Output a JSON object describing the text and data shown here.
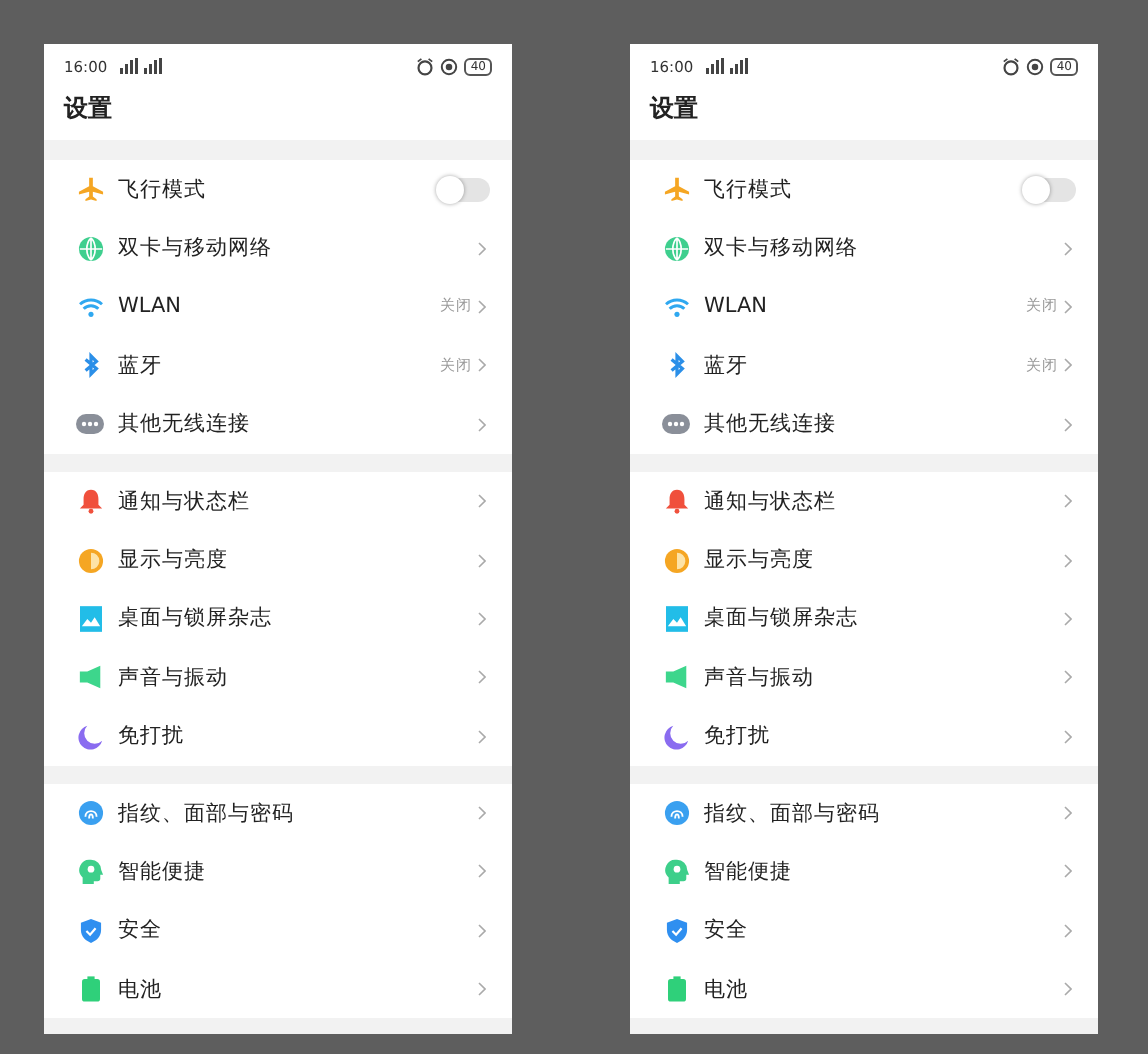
{
  "screens": [
    {
      "status_bar": {
        "time": "16:00",
        "battery": "40"
      },
      "title": "设置",
      "groups": [
        [
          {
            "kind": "toggle",
            "label": "飞行模式",
            "on": false
          },
          {
            "kind": "link",
            "label": "双卡与移动网络"
          },
          {
            "kind": "link",
            "label": "WLAN",
            "value": "关闭"
          },
          {
            "kind": "link",
            "label": "蓝牙",
            "value": "关闭"
          },
          {
            "kind": "link",
            "label": "其他无线连接"
          }
        ],
        [
          {
            "kind": "link",
            "label": "通知与状态栏"
          },
          {
            "kind": "link",
            "label": "显示与亮度"
          },
          {
            "kind": "link",
            "label": "桌面与锁屏杂志"
          },
          {
            "kind": "link",
            "label": "声音与振动"
          },
          {
            "kind": "link",
            "label": "免打扰"
          }
        ],
        [
          {
            "kind": "link",
            "label": "指纹、面部与密码"
          },
          {
            "kind": "link",
            "label": "智能便捷"
          },
          {
            "kind": "link",
            "label": "安全"
          },
          {
            "kind": "link",
            "label": "电池"
          }
        ]
      ]
    },
    {
      "status_bar": {
        "time": "16:00",
        "battery": "40"
      },
      "title": "设置",
      "groups": [
        [
          {
            "kind": "toggle",
            "label": "飞行模式",
            "on": false
          },
          {
            "kind": "link",
            "label": "双卡与移动网络"
          },
          {
            "kind": "link",
            "label": "WLAN",
            "value": "关闭"
          },
          {
            "kind": "link",
            "label": "蓝牙",
            "value": "关闭"
          },
          {
            "kind": "link",
            "label": "其他无线连接"
          }
        ],
        [
          {
            "kind": "link",
            "label": "通知与状态栏"
          },
          {
            "kind": "link",
            "label": "显示与亮度"
          },
          {
            "kind": "link",
            "label": "桌面与锁屏杂志"
          },
          {
            "kind": "link",
            "label": "声音与振动"
          },
          {
            "kind": "link",
            "label": "免打扰"
          }
        ],
        [
          {
            "kind": "link",
            "label": "指纹、面部与密码"
          },
          {
            "kind": "link",
            "label": "智能便捷"
          },
          {
            "kind": "link",
            "label": "安全"
          },
          {
            "kind": "link",
            "label": "电池"
          }
        ]
      ]
    }
  ]
}
